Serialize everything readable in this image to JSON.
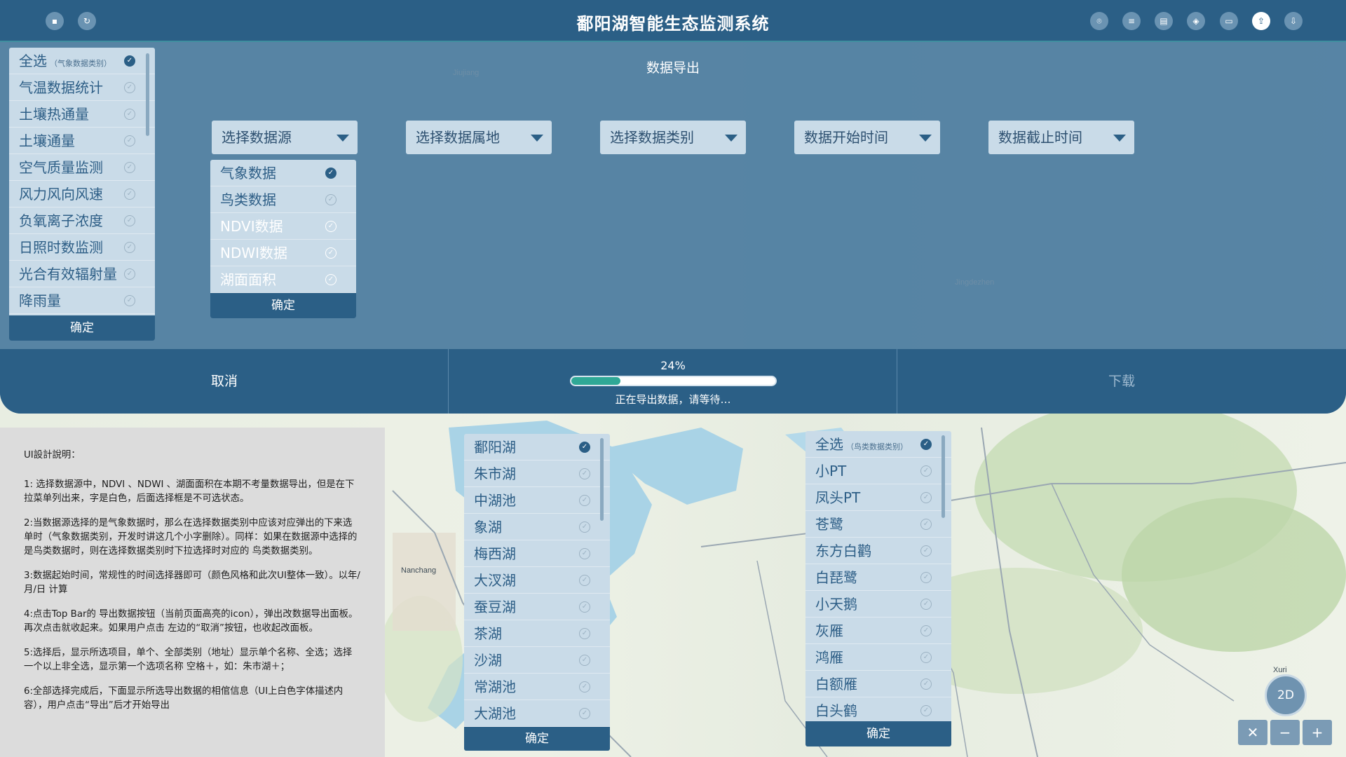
{
  "app": {
    "title": "鄱阳湖智能生态监测系统"
  },
  "panel": {
    "title": "数据导出"
  },
  "selectors": [
    {
      "label": "选择数据源"
    },
    {
      "label": "选择数据属地"
    },
    {
      "label": "选择数据类别"
    },
    {
      "label": "数据开始时间"
    },
    {
      "label": "数据截止时间"
    }
  ],
  "weather_categories": {
    "items": [
      {
        "label": "全选",
        "note": "（气象数据类别）",
        "checked": true
      },
      {
        "label": "气温数据统计",
        "checked": false
      },
      {
        "label": "土壤热通量",
        "checked": false
      },
      {
        "label": "土壤通量",
        "checked": false
      },
      {
        "label": "空气质量监测",
        "checked": false
      },
      {
        "label": "风力风向风速",
        "checked": false
      },
      {
        "label": "负氧离子浓度",
        "checked": false
      },
      {
        "label": "日照时数监测",
        "checked": false
      },
      {
        "label": "光合有效辐射量",
        "checked": false
      },
      {
        "label": "降雨量",
        "checked": false
      }
    ],
    "confirm": "确定"
  },
  "data_sources": {
    "items": [
      {
        "label": "气象数据",
        "checked": true,
        "enabled": true
      },
      {
        "label": "鸟类数据",
        "checked": false,
        "enabled": true
      },
      {
        "label": "NDVI数据",
        "checked": false,
        "enabled": false
      },
      {
        "label": "NDWI数据",
        "checked": false,
        "enabled": false
      },
      {
        "label": "湖面面积",
        "checked": false,
        "enabled": false
      }
    ],
    "confirm": "确定"
  },
  "action_bar": {
    "cancel": "取消",
    "progress_percent": "24%",
    "progress_value": 0.24,
    "progress_message": "正在导出数据，请等待…",
    "download": "下载"
  },
  "locations": {
    "items": [
      {
        "label": "鄱阳湖",
        "checked": true
      },
      {
        "label": "朱市湖",
        "checked": false
      },
      {
        "label": "中湖池",
        "checked": false
      },
      {
        "label": "象湖",
        "checked": false
      },
      {
        "label": "梅西湖",
        "checked": false
      },
      {
        "label": "大汊湖",
        "checked": false
      },
      {
        "label": "蚕豆湖",
        "checked": false
      },
      {
        "label": "茶湖",
        "checked": false
      },
      {
        "label": "沙湖",
        "checked": false
      },
      {
        "label": "常湖池",
        "checked": false
      },
      {
        "label": "大湖池",
        "checked": false
      }
    ],
    "confirm": "确定"
  },
  "bird_categories": {
    "items": [
      {
        "label": "全选",
        "note": "（鸟类数据类别）",
        "checked": true
      },
      {
        "label": "小PT",
        "checked": false
      },
      {
        "label": "凤头PT",
        "checked": false
      },
      {
        "label": "苍鹭",
        "checked": false
      },
      {
        "label": "东方白鹳",
        "checked": false
      },
      {
        "label": "白琵鹭",
        "checked": false
      },
      {
        "label": "小天鹅",
        "checked": false
      },
      {
        "label": "灰雁",
        "checked": false
      },
      {
        "label": "鸿雁",
        "checked": false
      },
      {
        "label": "白额雁",
        "checked": false
      },
      {
        "label": "白头鹤",
        "checked": false
      }
    ],
    "confirm": "确定"
  },
  "notes": {
    "heading": "UI設計說明：",
    "paragraphs": [
      "1: 选择数据源中，NDVI 、NDWI 、湖面面积在本期不考量数据导出，但是在下拉菜单列出来，字是白色，后面选择框是不可选状态。",
      "2:当数据源选择的是气象数据时，那么在选择数据类别中应该对应弹出的下来选单时（气象数据类别，开发时讲这几个小字删除）。同样：如果在数据源中选择的是鸟类数据时，则在选择数据类别时下拉选择时对应的 鸟类数据类别。",
      "3:数据起始时间，常规性的时间选择器即可（颜色风格和此次UI整体一致）。以年/月/日 计算",
      "4:点击Top  Bar的  导出数据按钮（当前页面高亮的icon），弹出改数据导出面板。再次点击就收起来。如果用户点击 左边的“取消”按钮，也收起改面板。",
      "5:选择后，显示所选项目，单个、全部类别（地址）显示单个名称、全选；选择一个以上非全选，显示第一个选项名称 空格＋，如：朱市湖＋；",
      "6:全部选择完成后，下面显示所选导出数据的相倌信息（UI上白色字体描述内容），用户点击“导出”后才开始导出"
    ]
  },
  "map": {
    "labels": [
      "Nanchang",
      "Xuri",
      "Jingdezhen",
      "Jiujiang"
    ],
    "mode_button": "2D",
    "zoom_in": "+",
    "zoom_out": "−",
    "fullscreen": "✕"
  },
  "colors": {
    "primary": "#2b5f86",
    "panel": "#4a7b9e",
    "list_bg": "#c9dbe8",
    "progress": "#2fa896",
    "water": "#a9d3e6",
    "land": "#e8eee2"
  },
  "topbar_icons": {
    "left": [
      "book-icon",
      "refresh-icon"
    ],
    "right": [
      "location-icon",
      "list-icon",
      "document-icon",
      "layers-icon",
      "monitor-icon",
      "export-icon",
      "download-icon"
    ]
  }
}
